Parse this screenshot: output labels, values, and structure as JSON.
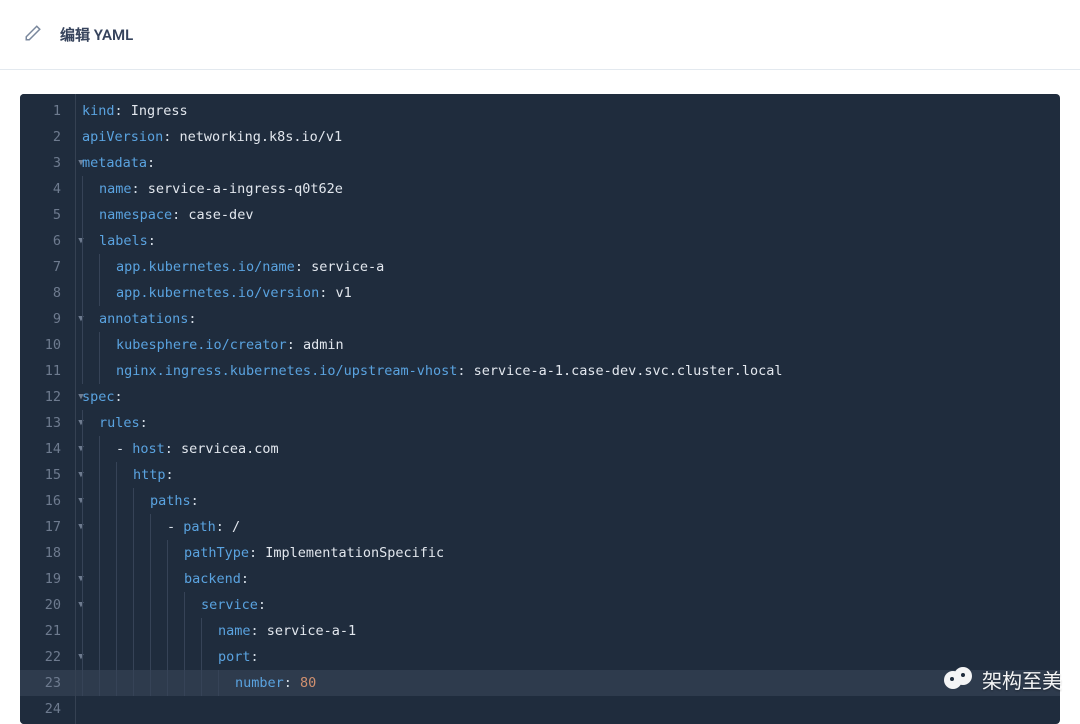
{
  "header": {
    "title": "编辑 YAML"
  },
  "editor": {
    "highlight_line": 23,
    "lines": [
      {
        "num": 1,
        "fold": false,
        "indent": 0,
        "tokens": [
          {
            "t": "key",
            "v": "kind"
          },
          {
            "t": "punc",
            "v": ": "
          },
          {
            "t": "str",
            "v": "Ingress"
          }
        ]
      },
      {
        "num": 2,
        "fold": false,
        "indent": 0,
        "tokens": [
          {
            "t": "key",
            "v": "apiVersion"
          },
          {
            "t": "punc",
            "v": ": "
          },
          {
            "t": "str",
            "v": "networking.k8s.io/v1"
          }
        ]
      },
      {
        "num": 3,
        "fold": true,
        "indent": 0,
        "tokens": [
          {
            "t": "key",
            "v": "metadata"
          },
          {
            "t": "punc",
            "v": ":"
          }
        ]
      },
      {
        "num": 4,
        "fold": false,
        "indent": 1,
        "tokens": [
          {
            "t": "key",
            "v": "name"
          },
          {
            "t": "punc",
            "v": ": "
          },
          {
            "t": "str",
            "v": "service-a-ingress-q0t62e"
          }
        ]
      },
      {
        "num": 5,
        "fold": false,
        "indent": 1,
        "tokens": [
          {
            "t": "key",
            "v": "namespace"
          },
          {
            "t": "punc",
            "v": ": "
          },
          {
            "t": "str",
            "v": "case-dev"
          }
        ]
      },
      {
        "num": 6,
        "fold": true,
        "indent": 1,
        "tokens": [
          {
            "t": "key",
            "v": "labels"
          },
          {
            "t": "punc",
            "v": ":"
          }
        ]
      },
      {
        "num": 7,
        "fold": false,
        "indent": 2,
        "tokens": [
          {
            "t": "key",
            "v": "app.kubernetes.io/name"
          },
          {
            "t": "punc",
            "v": ": "
          },
          {
            "t": "str",
            "v": "service-a"
          }
        ]
      },
      {
        "num": 8,
        "fold": false,
        "indent": 2,
        "tokens": [
          {
            "t": "key",
            "v": "app.kubernetes.io/version"
          },
          {
            "t": "punc",
            "v": ": "
          },
          {
            "t": "str",
            "v": "v1"
          }
        ]
      },
      {
        "num": 9,
        "fold": true,
        "indent": 1,
        "tokens": [
          {
            "t": "key",
            "v": "annotations"
          },
          {
            "t": "punc",
            "v": ":"
          }
        ]
      },
      {
        "num": 10,
        "fold": false,
        "indent": 2,
        "tokens": [
          {
            "t": "key",
            "v": "kubesphere.io/creator"
          },
          {
            "t": "punc",
            "v": ": "
          },
          {
            "t": "str",
            "v": "admin"
          }
        ]
      },
      {
        "num": 11,
        "fold": false,
        "indent": 2,
        "tokens": [
          {
            "t": "key",
            "v": "nginx.ingress.kubernetes.io/upstream-vhost"
          },
          {
            "t": "punc",
            "v": ": "
          },
          {
            "t": "str",
            "v": "service-a-1.case-dev.svc.cluster.local"
          }
        ]
      },
      {
        "num": 12,
        "fold": true,
        "indent": 0,
        "tokens": [
          {
            "t": "key",
            "v": "spec"
          },
          {
            "t": "punc",
            "v": ":"
          }
        ]
      },
      {
        "num": 13,
        "fold": true,
        "indent": 1,
        "tokens": [
          {
            "t": "key",
            "v": "rules"
          },
          {
            "t": "punc",
            "v": ":"
          }
        ]
      },
      {
        "num": 14,
        "fold": true,
        "indent": 2,
        "tokens": [
          {
            "t": "punc",
            "v": "- "
          },
          {
            "t": "key",
            "v": "host"
          },
          {
            "t": "punc",
            "v": ": "
          },
          {
            "t": "str",
            "v": "servicea.com"
          }
        ]
      },
      {
        "num": 15,
        "fold": true,
        "indent": 3,
        "tokens": [
          {
            "t": "key",
            "v": "http"
          },
          {
            "t": "punc",
            "v": ":"
          }
        ]
      },
      {
        "num": 16,
        "fold": true,
        "indent": 4,
        "tokens": [
          {
            "t": "key",
            "v": "paths"
          },
          {
            "t": "punc",
            "v": ":"
          }
        ]
      },
      {
        "num": 17,
        "fold": true,
        "indent": 5,
        "tokens": [
          {
            "t": "punc",
            "v": "- "
          },
          {
            "t": "key",
            "v": "path"
          },
          {
            "t": "punc",
            "v": ": "
          },
          {
            "t": "str",
            "v": "/"
          }
        ]
      },
      {
        "num": 18,
        "fold": false,
        "indent": 6,
        "tokens": [
          {
            "t": "key",
            "v": "pathType"
          },
          {
            "t": "punc",
            "v": ": "
          },
          {
            "t": "str",
            "v": "ImplementationSpecific"
          }
        ]
      },
      {
        "num": 19,
        "fold": true,
        "indent": 6,
        "tokens": [
          {
            "t": "key",
            "v": "backend"
          },
          {
            "t": "punc",
            "v": ":"
          }
        ]
      },
      {
        "num": 20,
        "fold": true,
        "indent": 7,
        "tokens": [
          {
            "t": "key",
            "v": "service"
          },
          {
            "t": "punc",
            "v": ":"
          }
        ]
      },
      {
        "num": 21,
        "fold": false,
        "indent": 8,
        "tokens": [
          {
            "t": "key",
            "v": "name"
          },
          {
            "t": "punc",
            "v": ": "
          },
          {
            "t": "str",
            "v": "service-a-1"
          }
        ]
      },
      {
        "num": 22,
        "fold": true,
        "indent": 8,
        "tokens": [
          {
            "t": "key",
            "v": "port"
          },
          {
            "t": "punc",
            "v": ":"
          }
        ]
      },
      {
        "num": 23,
        "fold": false,
        "indent": 9,
        "tokens": [
          {
            "t": "key",
            "v": "number"
          },
          {
            "t": "punc",
            "v": ": "
          },
          {
            "t": "num",
            "v": "80"
          }
        ]
      },
      {
        "num": 24,
        "fold": false,
        "indent": 0,
        "tokens": []
      }
    ]
  },
  "watermark": {
    "text": "架构至美"
  }
}
